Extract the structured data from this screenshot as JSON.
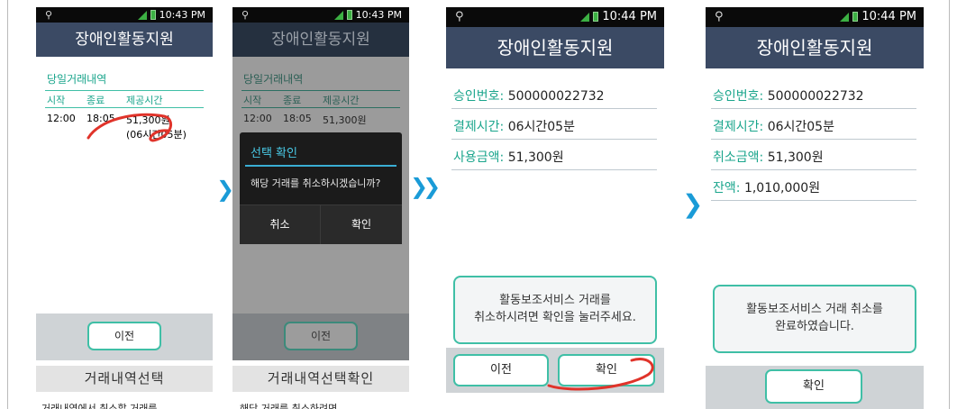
{
  "colors": {
    "accent": "#1aa58c",
    "button_border": "#3fbfa6",
    "titlebar": "#3b4a64",
    "chevron": "#1a9bd7",
    "annotation": "#e0332a"
  },
  "screen1": {
    "time": "10:43 PM",
    "title": "장애인활동지원",
    "section": "당일거래내역",
    "col_start": "시작",
    "col_end": "종료",
    "col_time": "제공시간",
    "row_start": "12:00",
    "row_end": "18:05",
    "row_amount": "51,300원",
    "row_duration": "(06시간05분)",
    "btn_prev": "이전",
    "caption": "거래내역선택",
    "desc": "거래내역에서 취소할 거래를"
  },
  "screen2": {
    "time": "10:43 PM",
    "title": "장애인활동지원",
    "section": "당일거래내역",
    "col_start": "시작",
    "col_end": "종료",
    "col_time": "제공시간",
    "row_start": "12:00",
    "row_end": "18:05",
    "row_amount": "51,300원",
    "dialog_title": "선택 확인",
    "dialog_msg": "해당 거래를 취소하시겠습니까?",
    "dialog_cancel": "취소",
    "dialog_ok": "확인",
    "btn_prev": "이전",
    "caption": "거래내역선택확인",
    "desc": "해당 거래를 취소하려면"
  },
  "screen3": {
    "time": "10:44 PM",
    "title": "장애인활동지원",
    "approval_label": "승인번호:",
    "approval_value": "500000022732",
    "paytime_label": "결제시간:",
    "paytime_value": "06시간05분",
    "amount_label": "사용금액:",
    "amount_value": "51,300원",
    "msg_line1": "활동보조서비스 거래를",
    "msg_line2": "취소하시려면 확인을 눌러주세요.",
    "btn_prev": "이전",
    "btn_ok": "확인"
  },
  "screen4": {
    "time": "10:44 PM",
    "title": "장애인활동지원",
    "approval_label": "승인번호:",
    "approval_value": "500000022732",
    "paytime_label": "결제시간:",
    "paytime_value": "06시간05분",
    "cancel_label": "취소금액:",
    "cancel_value": "51,300원",
    "balance_label": "잔액:",
    "balance_value": "1,010,000원",
    "msg_line1": "활동보조서비스 거래 취소를",
    "msg_line2": "완료하였습니다.",
    "btn_ok": "확인"
  },
  "chevrons": {
    "single": "❯",
    "double": "❯❯"
  }
}
